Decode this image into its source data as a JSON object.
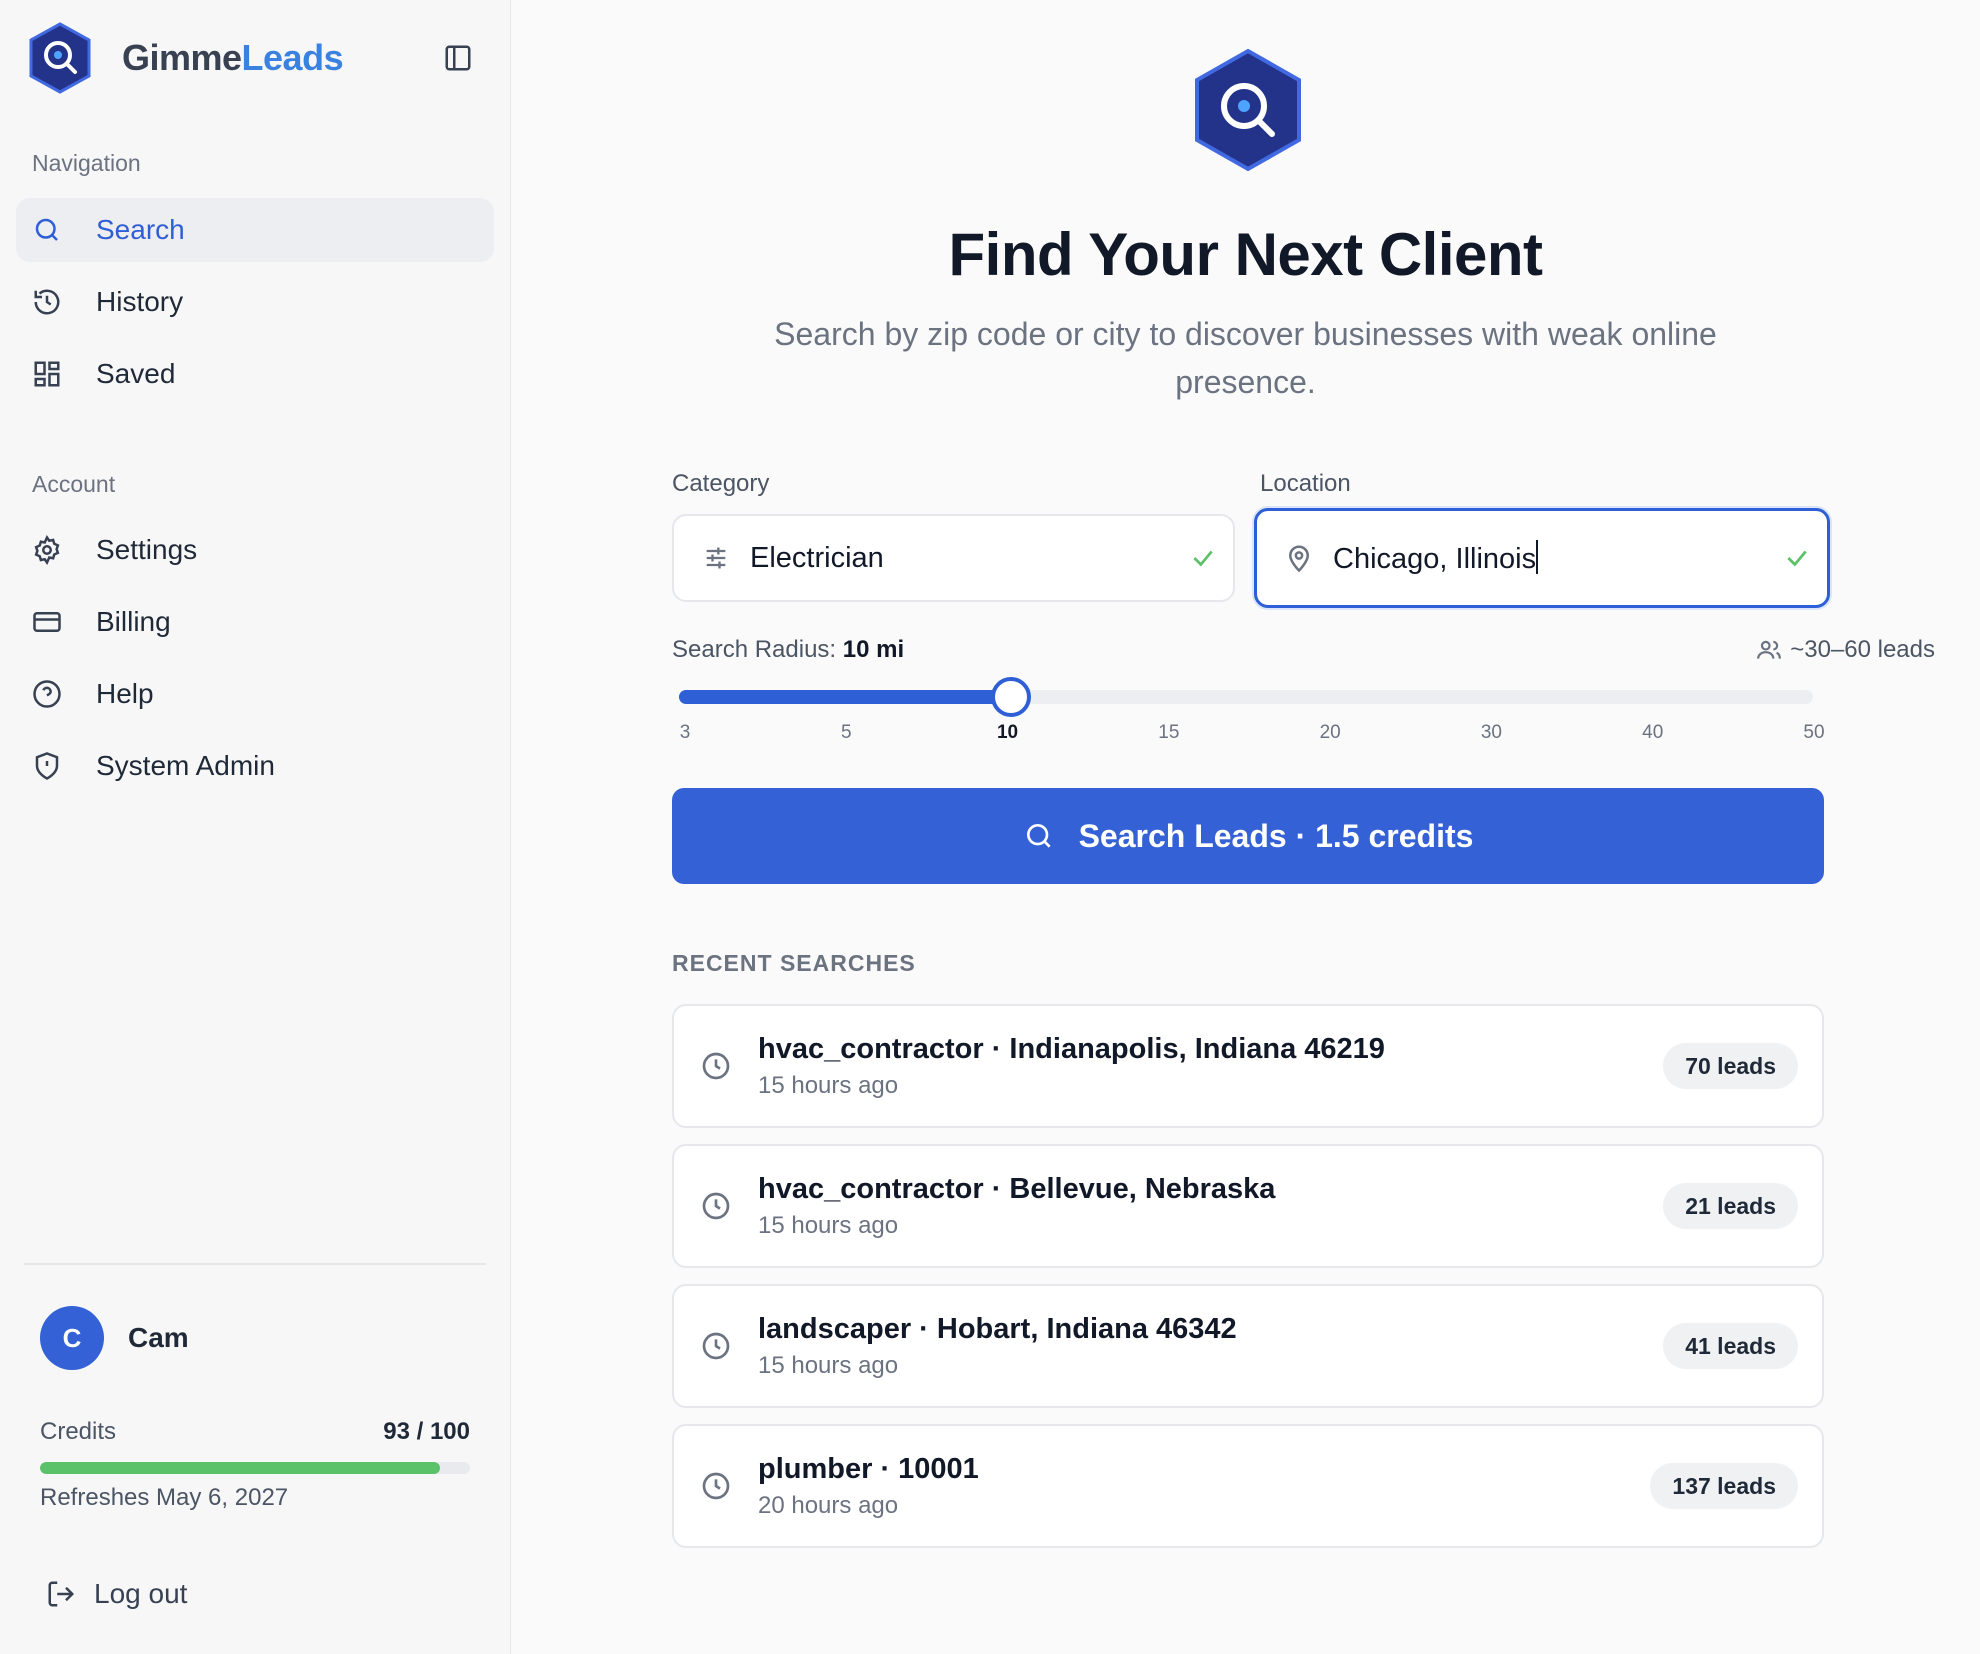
{
  "brand": {
    "name_part1": "Gimme",
    "name_part2": "Leads"
  },
  "sidebar": {
    "navigation_label": "Navigation",
    "nav_items": [
      {
        "label": "Search",
        "icon": "search-icon",
        "active": true
      },
      {
        "label": "History",
        "icon": "history-icon",
        "active": false
      },
      {
        "label": "Saved",
        "icon": "grid-icon",
        "active": false
      }
    ],
    "account_label": "Account",
    "account_items": [
      {
        "label": "Settings",
        "icon": "gear-icon"
      },
      {
        "label": "Billing",
        "icon": "credit-card-icon"
      },
      {
        "label": "Help",
        "icon": "help-circle-icon"
      },
      {
        "label": "System Admin",
        "icon": "shield-icon"
      }
    ],
    "user": {
      "initial": "C",
      "name": "Cam"
    },
    "credits": {
      "label": "Credits",
      "value": "93 / 100",
      "used": 93,
      "total": 100,
      "refresh_text": "Refreshes May 6, 2027"
    },
    "logout_label": "Log out"
  },
  "main": {
    "title": "Find Your Next Client",
    "subtitle": "Search by zip code or city to discover businesses with weak online presence.",
    "category": {
      "label": "Category",
      "value": "Electrician"
    },
    "location": {
      "label": "Location",
      "value": "Chicago, Illinois"
    },
    "radius": {
      "label": "Search Radius:",
      "value": "10 mi",
      "selected": "10",
      "ticks": [
        "3",
        "5",
        "10",
        "15",
        "20",
        "30",
        "40",
        "50"
      ],
      "estimate": "~30–60 leads"
    },
    "search_button": "Search Leads · 1.5 credits",
    "recent_title": "RECENT SEARCHES",
    "recent": [
      {
        "query": "hvac_contractor · Indianapolis, Indiana 46219",
        "time": "15 hours ago",
        "leads": "70 leads"
      },
      {
        "query": "hvac_contractor · Bellevue, Nebraska",
        "time": "15 hours ago",
        "leads": "21 leads"
      },
      {
        "query": "landscaper · Hobart, Indiana 46342",
        "time": "15 hours ago",
        "leads": "41 leads"
      },
      {
        "query": "plumber · 10001",
        "time": "20 hours ago",
        "leads": "137 leads"
      }
    ]
  },
  "colors": {
    "accent": "#3461d6",
    "brand_light": "#3b82e0",
    "credits_bar": "#5cc26a",
    "check": "#5cc26a"
  }
}
